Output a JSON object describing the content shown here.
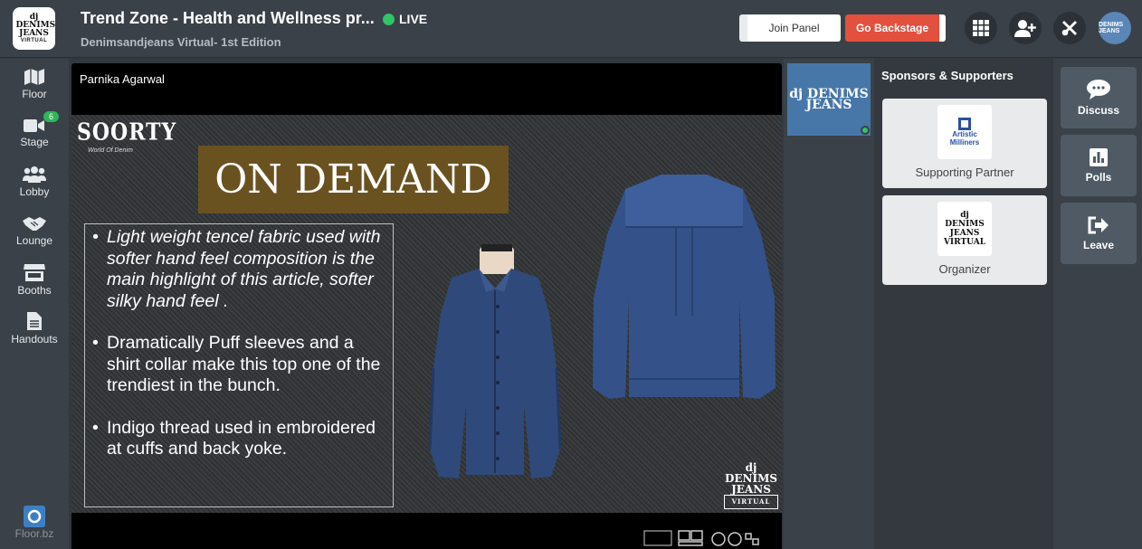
{
  "header": {
    "title": "Trend Zone - Health and Wellness pr...",
    "live_label": "LIVE",
    "subtitle": "Denimsandjeans Virtual- 1st Edition",
    "join_panel_label": "Join Panel",
    "go_backstage_label": "Go Backstage",
    "avatar_text": "DENIMS JEANS"
  },
  "logo": {
    "line1": "dj DENIMS JEANS",
    "line2": "VIRTUAL"
  },
  "sidebar": {
    "items": [
      {
        "label": "Floor",
        "icon": "map-icon"
      },
      {
        "label": "Stage",
        "icon": "video-camera-icon",
        "badge": "6"
      },
      {
        "label": "Lobby",
        "icon": "people-icon"
      },
      {
        "label": "Lounge",
        "icon": "handshake-icon"
      },
      {
        "label": "Booths",
        "icon": "store-icon"
      },
      {
        "label": "Handouts",
        "icon": "document-icon"
      }
    ],
    "footer_label": "Floor.bz"
  },
  "stage": {
    "speaker_name": "Parnika Agarwal",
    "slide": {
      "brand": "SOORTY",
      "brand_tagline": "World Of Denim",
      "heading": "ON DEMAND",
      "bullets": [
        "Light weight tencel fabric used with softer hand feel composition is the main highlight of this article, softer silky  hand feel .",
        "Dramatically Puff sleeves and a shirt collar make this top one of the trendiest in the bunch.",
        "Indigo thread used in embroidered at cuffs and back yoke."
      ],
      "watermark_top": "dj DENIMS JEANS",
      "watermark_bottom": "VIRTUAL"
    }
  },
  "participant_thumb": {
    "text": "dj DENIMS JEANS"
  },
  "sponsors": {
    "title": "Sponsors & Supporters",
    "cards": [
      {
        "logo_text": "Artistic Milliners",
        "label": "Supporting Partner"
      },
      {
        "logo_text": "dj DENIMS JEANS VIRTUAL",
        "label": "Organizer"
      }
    ]
  },
  "right_panel": {
    "buttons": [
      {
        "label": "Discuss",
        "icon": "chat-icon"
      },
      {
        "label": "Polls",
        "icon": "poll-icon"
      },
      {
        "label": "Leave",
        "icon": "exit-icon"
      }
    ]
  },
  "colors": {
    "live": "#2fc464",
    "backstage": "#e3503e",
    "heading_bg": "#6a5220"
  }
}
